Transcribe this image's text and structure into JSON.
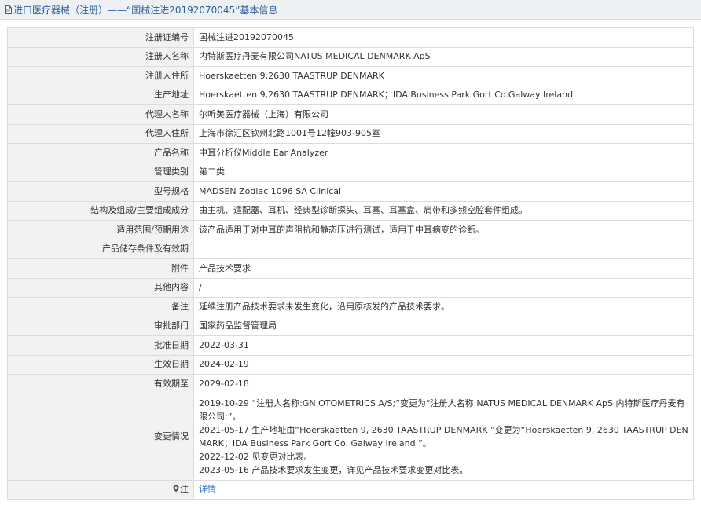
{
  "header": {
    "title": "进口医疗器械（注册）——“国械注进20192070045”基本信息"
  },
  "rows": [
    {
      "label": "注册证编号",
      "value": "国械注进20192070045"
    },
    {
      "label": "注册人名称",
      "value": "内特斯医疗丹麦有限公司NATUS MEDICAL DENMARK ApS"
    },
    {
      "label": "注册人住所",
      "value": "Hoerskaetten 9,2630 TAASTRUP DENMARK"
    },
    {
      "label": "生产地址",
      "value": "Hoerskaetten 9,2630 TAASTRUP DENMARK；IDA Business Park Gort Co.Galway Ireland"
    },
    {
      "label": "代理人名称",
      "value": "尔听美医疗器械（上海）有限公司"
    },
    {
      "label": "代理人住所",
      "value": "上海市徐汇区钦州北路1001号12幢903-905室"
    },
    {
      "label": "产品名称",
      "value": "中耳分析仪Middle Ear Analyzer"
    },
    {
      "label": "管理类别",
      "value": "第二类"
    },
    {
      "label": "型号规格",
      "value": "MADSEN Zodiac 1096 SA Clinical"
    },
    {
      "label": "结构及组成/主要组成成分",
      "value": "由主机、适配器、耳机、经典型诊断探头、耳塞、耳塞盒、肩带和多频空腔套件组成。"
    },
    {
      "label": "适用范围/预期用途",
      "value": "该产品适用于对中耳的声阻抗和静态压进行测试，适用于中耳病变的诊断。"
    },
    {
      "label": "产品储存条件及有效期",
      "value": ""
    },
    {
      "label": "附件",
      "value": "产品技术要求"
    },
    {
      "label": "其他内容",
      "value": "/"
    },
    {
      "label": "备注",
      "value": "延续注册产品技术要求未发生变化，沿用原核发的产品技术要求。"
    },
    {
      "label": "审批部门",
      "value": "国家药品监督管理局"
    },
    {
      "label": "批准日期",
      "value": "2022-03-31"
    },
    {
      "label": "生效日期",
      "value": "2024-02-19"
    },
    {
      "label": "有效期至",
      "value": "2029-02-18"
    }
  ],
  "changes": {
    "label": "变更情况",
    "lines": [
      "2019-10-29 “注册人名称:GN OTOMETRICS A/S;”变更为“注册人名称:NATUS MEDICAL DENMARK ApS 内特斯医疗丹麦有限公司;”。",
      "2021-05-17 生产地址由“Hoerskaetten 9, 2630 TAASTRUP DENMARK ”变更为“Hoerskaetten 9, 2630 TAASTRUP DENMARK；IDA Business Park Gort Co. Galway Ireland ”。",
      "2022-12-02 见变更对比表。",
      "2023-05-16 产品技术要求发生变更，详见产品技术要求变更对比表。"
    ]
  },
  "note": {
    "label": "注",
    "link_text": "详情"
  },
  "colors": {
    "title_text": "#2f5f9a",
    "header_bg": "#eef1f4",
    "label_bg": "#f2f2f2",
    "border": "#dcdcdc",
    "link": "#2a6fbd"
  }
}
